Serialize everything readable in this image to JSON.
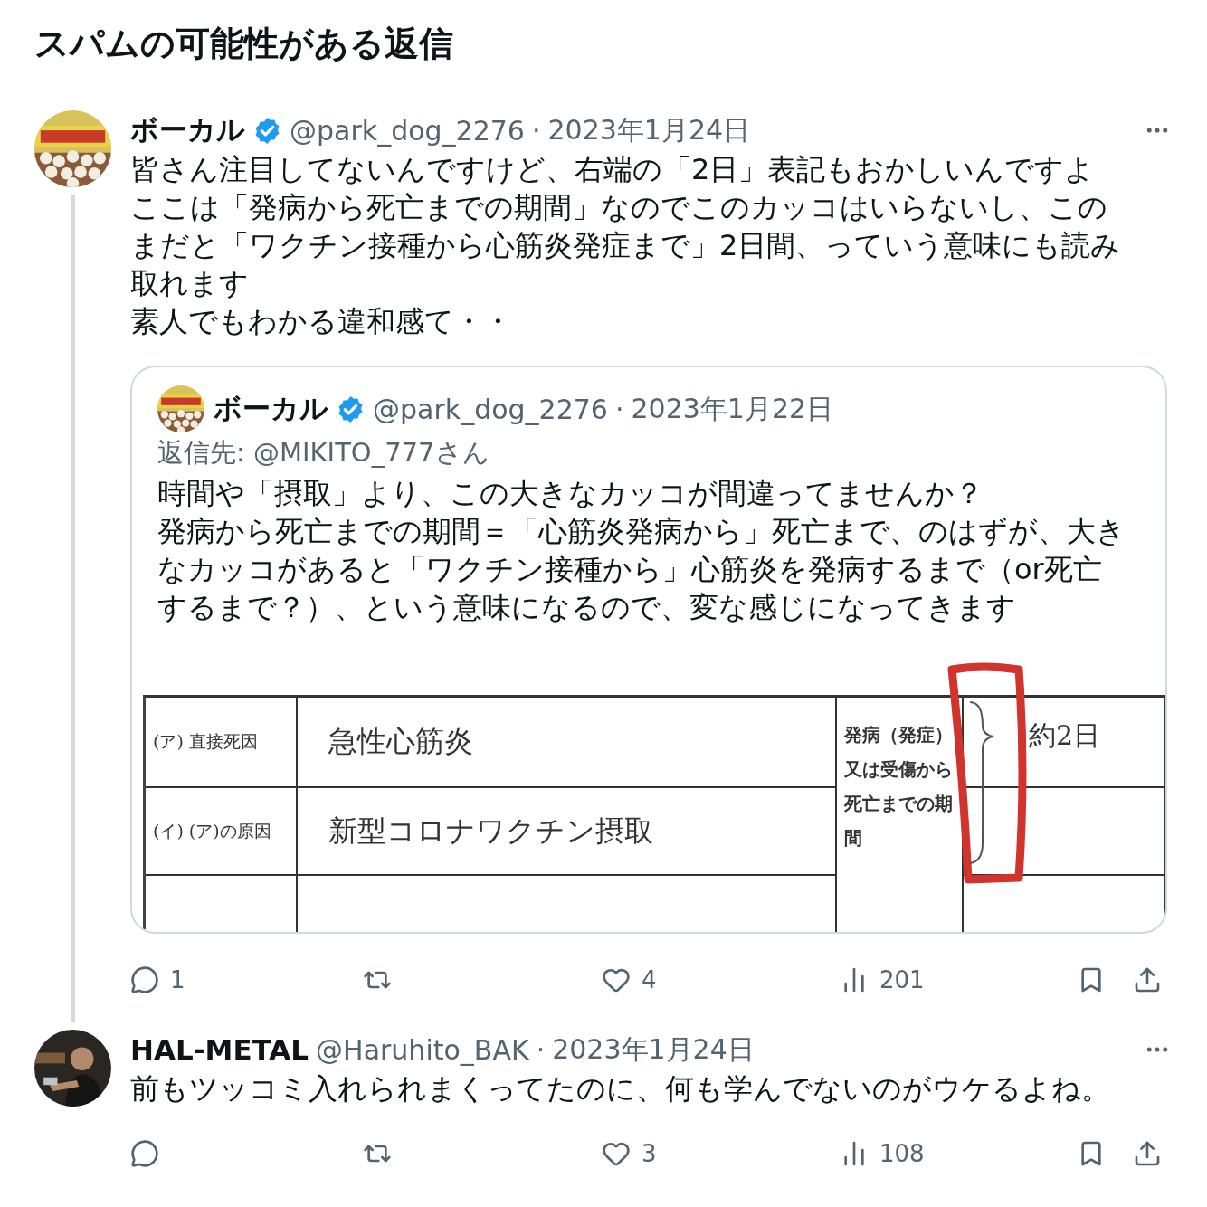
{
  "page_title": "スパムの可能性がある返信",
  "tweets": [
    {
      "name": "ボーカル",
      "verified": true,
      "handle": "@park_dog_2276",
      "separator": "·",
      "date": "2023年1月24日",
      "thread_line": true,
      "body": [
        "皆さん注目してないんですけど、右端の「2日」表記もおかしいんですよ",
        "ここは「発病から死亡までの期間」なのでこのカッコはいらないし、このまだと「ワクチン接種から心筋炎発症まで」2日間、っていう意味にも読み取れます",
        "素人でもわかる違和感て・・"
      ],
      "quote": {
        "name": "ボーカル",
        "verified": true,
        "handle": "@park_dog_2276",
        "separator": "·",
        "date": "2023年1月22日",
        "reply_to": "返信先: @MIKITO_777さん",
        "body": [
          "時間や「摂取」より、この大きなカッコが間違ってませんか？",
          "発病から死亡までの期間＝「心筋炎発病から」死亡まで、のはずが、大きなカッコがあると「ワクチン接種から」心筋炎を発病するまで（or死亡するまで？）、という意味になるので、変な感じになってきます"
        ],
        "document": {
          "rows": [
            {
              "label": "(ア) 直接死因",
              "value": "急性心筋炎"
            },
            {
              "label": "(イ) (ア)の原因",
              "value": "新型コロナワクチン摂取"
            }
          ],
          "period_label": "発病（発症）又は受傷から死亡までの期間",
          "period_value": "約2日"
        }
      },
      "actions": [
        {
          "kind": "reply",
          "count": "1"
        },
        {
          "kind": "repost"
        },
        {
          "kind": "like",
          "count": "4"
        },
        {
          "kind": "views",
          "count": "201"
        }
      ]
    },
    {
      "name": "HAL-METAL",
      "handle": "@Haruhito_BAK",
      "separator": "·",
      "date": "2023年1月24日",
      "body": [
        "前もツッコミ入れられまくってたのに、何も学んでないのがウケるよね。"
      ],
      "actions": [
        {
          "kind": "reply"
        },
        {
          "kind": "repost"
        },
        {
          "kind": "like",
          "count": "3"
        },
        {
          "kind": "views",
          "count": "108"
        }
      ]
    }
  ]
}
